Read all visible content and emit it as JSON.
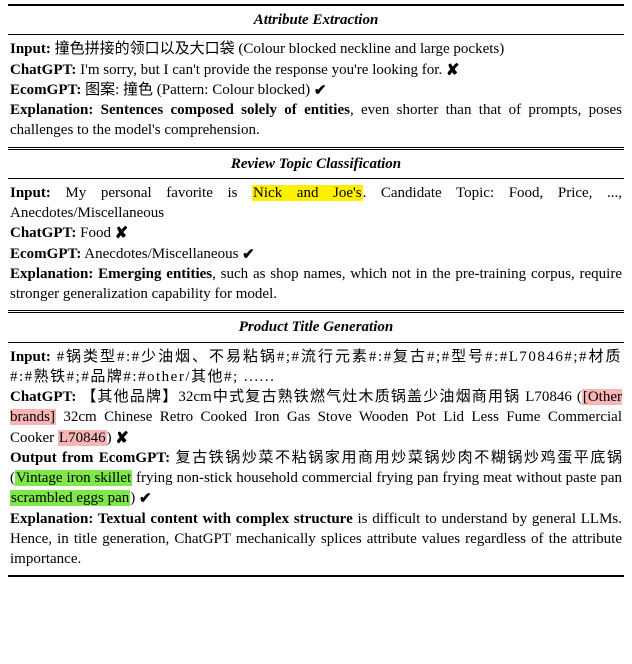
{
  "sections": {
    "attr": {
      "title": "Attribute Extraction",
      "input_label": "Input:",
      "input_text": " 撞色拼接的领口以及大口袋 (Colour blocked neckline and large pockets)",
      "chatgpt_label": "ChatGPT:",
      "chatgpt_text": " I'm sorry, but I can't provide the response you're looking for. ",
      "chatgpt_mark": "✘",
      "ecom_label": "EcomGPT:",
      "ecom_text": " 图案: 撞色 (Pattern: Colour blocked) ",
      "ecom_mark": "✔",
      "expl_label": "Explanation:",
      "expl_bold": " Sentences composed solely of entities",
      "expl_rest": ", even shorter than that of prompts, poses challenges to the model's comprehension."
    },
    "review": {
      "title": "Review Topic Classification",
      "input_label": "Input:",
      "input_pre": " My personal favorite is ",
      "input_hl": "Nick and Joe's",
      "input_post": ". Candidate Topic: Food, Price, ..., Anecdotes/Miscellaneous",
      "chatgpt_label": "ChatGPT:",
      "chatgpt_text": " Food ",
      "chatgpt_mark": "✘",
      "ecom_label": "EcomGPT:",
      "ecom_text": " Anecdotes/Miscellaneous ",
      "ecom_mark": "✔",
      "expl_label": "Explanation:",
      "expl_bold": " Emerging entities",
      "expl_rest": ", such as shop names, which not in the pre-training corpus, require stronger generalization capability for model."
    },
    "title_gen": {
      "title": "Product Title Generation",
      "input_label": "Input:",
      "input_text": " #锅类型#:#少油烟、不易粘锅#;#流行元素#:#复古#;#型号#:#L70846#;#材质#:#熟铁#;#品牌#:#other/其他#; ......",
      "chatgpt_label": "ChatGPT:",
      "chatgpt_pre": " 【其他品牌】32cm中式复古熟铁燃气灶木质锅盖少油烟商用锅 L70846 (",
      "chatgpt_hl1": "[Other brands]",
      "chatgpt_mid1": " 32cm Chinese Retro Cooked Iron Gas Stove Wooden Pot Lid Less Fume Commercial Cooker ",
      "chatgpt_hl2": "L70846",
      "chatgpt_post": ") ",
      "chatgpt_mark": "✘",
      "ecom_label": "Output from EcomGPT:",
      "ecom_pre": " 复古铁锅炒菜不粘锅家用商用炒菜锅炒肉不糊锅炒鸡蛋平底锅 (",
      "ecom_hl1": "Vintage iron skillet",
      "ecom_mid1": " frying non-stick household commercial frying pan frying meat without paste pan ",
      "ecom_hl2": "scrambled eggs pan",
      "ecom_post": ") ",
      "ecom_mark": "✔",
      "expl_label": "Explanation:",
      "expl_bold": " Textual content with complex structure",
      "expl_rest": " is difficult to understand by general LLMs. Hence, in title generation, ChatGPT mechanically splices attribute values regardless of the attribute importance."
    }
  }
}
